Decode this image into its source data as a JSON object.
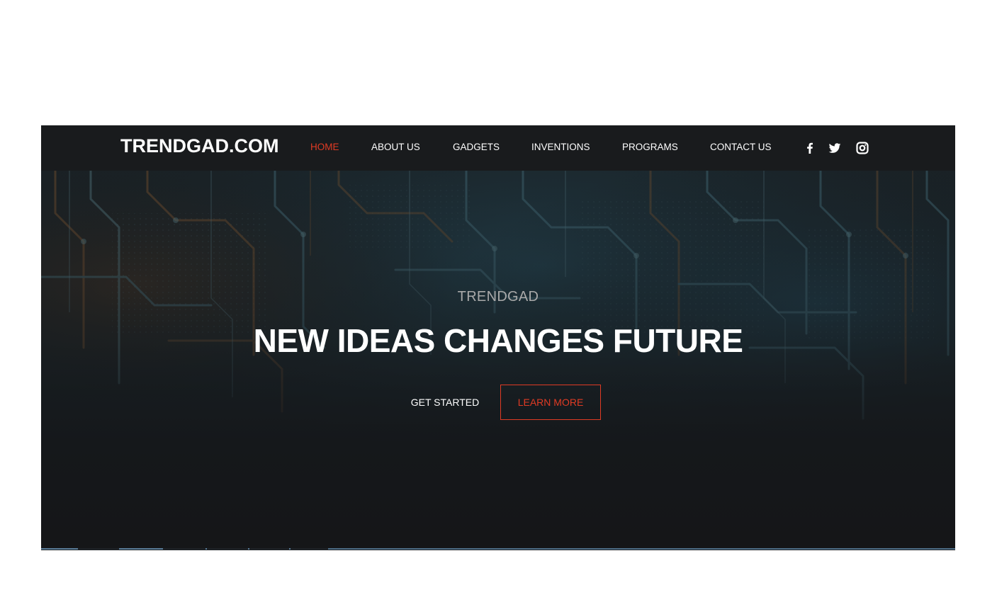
{
  "navbar": {
    "logo": "TRENDGAD.COM",
    "items": [
      {
        "label": "HOME",
        "active": true
      },
      {
        "label": "ABOUT US",
        "active": false
      },
      {
        "label": "GADGETS",
        "active": false
      },
      {
        "label": "INVENTIONS",
        "active": false
      },
      {
        "label": "PROGRAMS",
        "active": false
      },
      {
        "label": "CONTACT US",
        "active": false
      }
    ],
    "social_icons": [
      "facebook-icon",
      "twitter-icon",
      "instagram-icon"
    ]
  },
  "hero": {
    "subtitle": "TRENDGAD",
    "title": "NEW IDEAS CHANGES FUTURE",
    "primary_button": "GET STARTED",
    "secondary_button": "LEARN MORE",
    "background": "circuit-board-image"
  },
  "colors": {
    "accent": "#e03b24",
    "navbar_bg": "#191b1d",
    "text": "#ffffff",
    "subtitle": "#a9a9a9"
  }
}
